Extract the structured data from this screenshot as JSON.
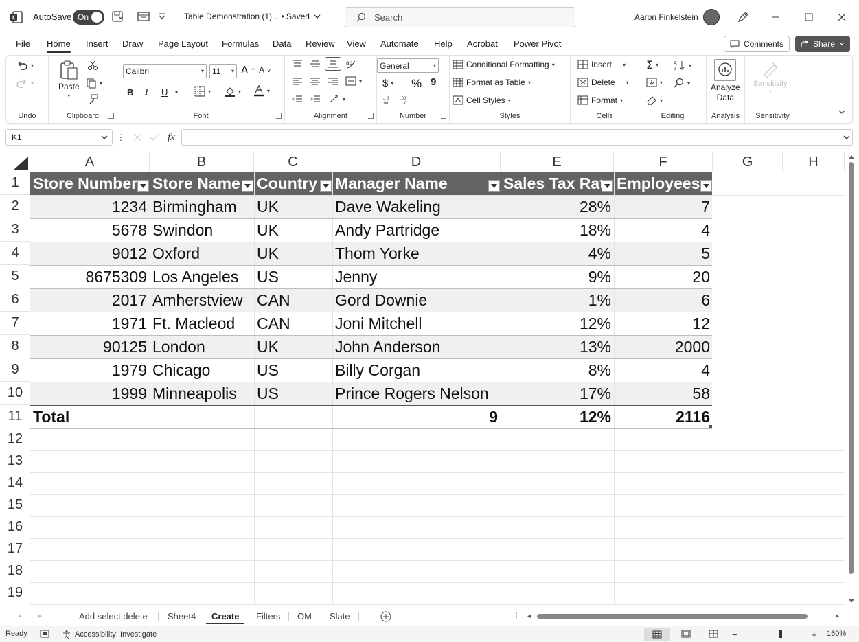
{
  "titlebar": {
    "autosave_label": "AutoSave",
    "autosave_state": "On",
    "document_title": "Table Demonstration (1)... • Saved",
    "search_placeholder": "Search",
    "user_name": "Aaron Finkelstein"
  },
  "menu": {
    "tabs": [
      "File",
      "Home",
      "Insert",
      "Draw",
      "Page Layout",
      "Formulas",
      "Data",
      "Review",
      "View",
      "Automate",
      "Help",
      "Acrobat",
      "Power Pivot"
    ],
    "active_tab": "Home",
    "comments_label": "Comments",
    "share_label": "Share"
  },
  "ribbon": {
    "groups": {
      "undo": "Undo",
      "clipboard": "Clipboard",
      "font": "Font",
      "alignment": "Alignment",
      "number": "Number",
      "styles": "Styles",
      "cells": "Cells",
      "editing": "Editing",
      "analysis": "Analysis",
      "sensitivity": "Sensitivity"
    },
    "paste_label": "Paste",
    "font_name": "Calibri",
    "font_size": "11",
    "number_format": "General",
    "conditional_formatting": "Conditional Formatting",
    "format_as_table": "Format as Table",
    "cell_styles": "Cell Styles",
    "insert_label": "Insert",
    "delete_label": "Delete",
    "format_label": "Format",
    "analyze_data_line1": "Analyze",
    "analyze_data_line2": "Data",
    "sensitivity_button": "Sensitivity",
    "bold": "B",
    "italic": "I",
    "underline": "U",
    "currency": "$",
    "percent": "%",
    "comma": "9"
  },
  "formula_bar": {
    "name_box": "K1",
    "fx": "fx",
    "formula": ""
  },
  "sheet": {
    "columns": [
      "A",
      "B",
      "C",
      "D",
      "E",
      "F",
      "G",
      "H"
    ],
    "rows": [
      "1",
      "2",
      "3",
      "4",
      "5",
      "6",
      "7",
      "8",
      "9",
      "10",
      "11",
      "12",
      "13",
      "14",
      "15",
      "16",
      "17",
      "18",
      "19"
    ],
    "table_headers": [
      "Store Number",
      "Store Name",
      "Country",
      "Manager Name",
      "Sales Tax Rate",
      "Employees"
    ],
    "table_rows": [
      [
        "1234",
        "Birmingham",
        "UK",
        "Dave Wakeling",
        "28%",
        "7"
      ],
      [
        "5678",
        "Swindon",
        "UK",
        "Andy Partridge",
        "18%",
        "4"
      ],
      [
        "9012",
        "Oxford",
        "UK",
        "Thom Yorke",
        "4%",
        "5"
      ],
      [
        "8675309",
        "Los Angeles",
        "US",
        "Jenny",
        "9%",
        "20"
      ],
      [
        "2017",
        "Amherstview",
        "CAN",
        "Gord Downie",
        "1%",
        "6"
      ],
      [
        "1971",
        "Ft. Macleod",
        "CAN",
        "Joni Mitchell",
        "12%",
        "12"
      ],
      [
        "90125",
        "London",
        "UK",
        "John Anderson",
        "13%",
        "2000"
      ],
      [
        "1979",
        "Chicago",
        "US",
        "Billy Corgan",
        "8%",
        "4"
      ],
      [
        "1999",
        "Minneapolis",
        "US",
        "Prince Rogers Nelson",
        "17%",
        "58"
      ]
    ],
    "total_row": [
      "Total",
      "",
      "",
      "9",
      "12%",
      "2116"
    ]
  },
  "sheet_tabs": {
    "tabs": [
      "Add select delete",
      "Sheet4",
      "Create",
      "Filters",
      "OM",
      "Slate"
    ],
    "active": "Create"
  },
  "status": {
    "ready": "Ready",
    "accessibility": "Accessibility: Investigate",
    "zoom": "160%"
  },
  "colors": {
    "table_header_bg": "#636363",
    "band_bg": "#f0f0f0",
    "accent": "#333333"
  }
}
